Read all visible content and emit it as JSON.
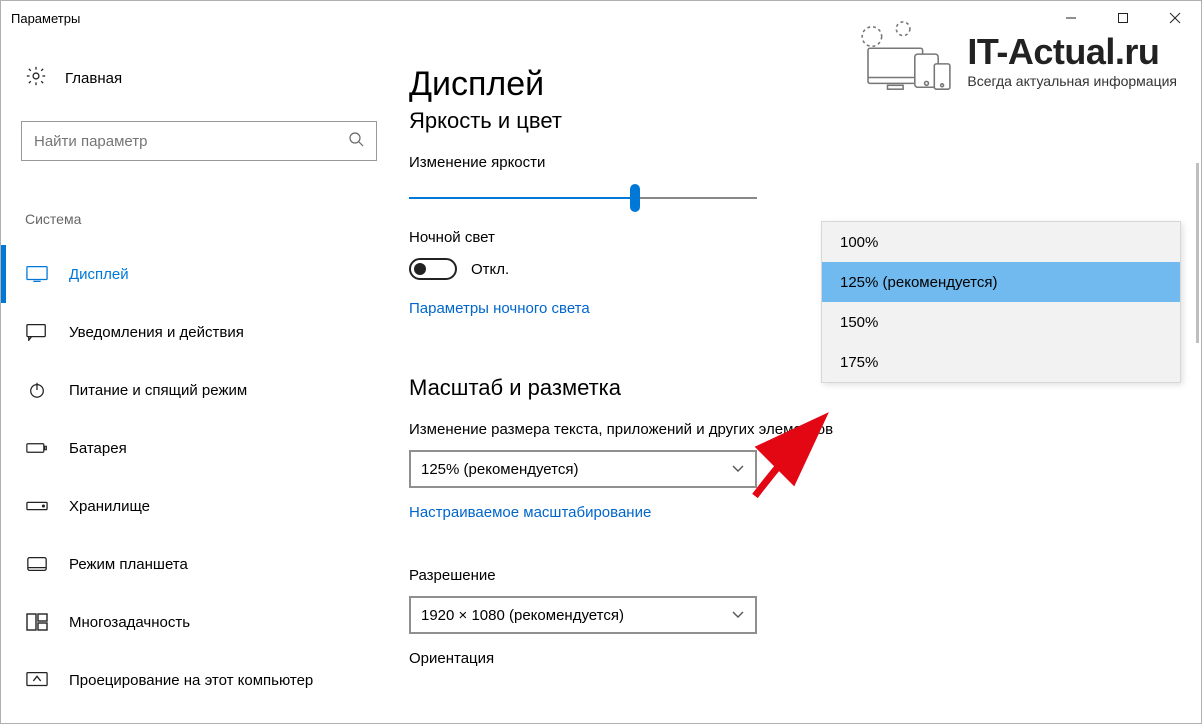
{
  "window": {
    "title": "Параметры"
  },
  "sidebar": {
    "home_label": "Главная",
    "search_placeholder": "Найти параметр",
    "category_header": "Система",
    "items": [
      {
        "label": "Дисплей"
      },
      {
        "label": "Уведомления и действия"
      },
      {
        "label": "Питание и спящий режим"
      },
      {
        "label": "Батарея"
      },
      {
        "label": "Хранилище"
      },
      {
        "label": "Режим планшета"
      },
      {
        "label": "Многозадачность"
      },
      {
        "label": "Проецирование на этот компьютер"
      }
    ]
  },
  "content": {
    "title": "Дисплей",
    "section_brightness": "Яркость и цвет",
    "brightness_label": "Изменение яркости",
    "brightness_value_percent": 65,
    "night_light_label": "Ночной свет",
    "night_light_state": "Откл.",
    "night_light_link": "Параметры ночного света",
    "section_scale": "Масштаб и разметка",
    "scale_label": "Изменение размера текста, приложений и других элементов",
    "scale_combo_value": "125% (рекомендуется)",
    "custom_scaling_link": "Настраиваемое масштабирование",
    "resolution_label": "Разрешение",
    "resolution_combo_value": "1920 × 1080 (рекомендуется)",
    "orientation_label": "Ориентация"
  },
  "dropdown": {
    "options": [
      {
        "label": "100%"
      },
      {
        "label": "125% (рекомендуется)"
      },
      {
        "label": "150%"
      },
      {
        "label": "175%"
      }
    ],
    "selected_index": 1
  },
  "watermark": {
    "title": "IT-Actual.ru",
    "subtitle": "Всегда актуальная информация"
  }
}
